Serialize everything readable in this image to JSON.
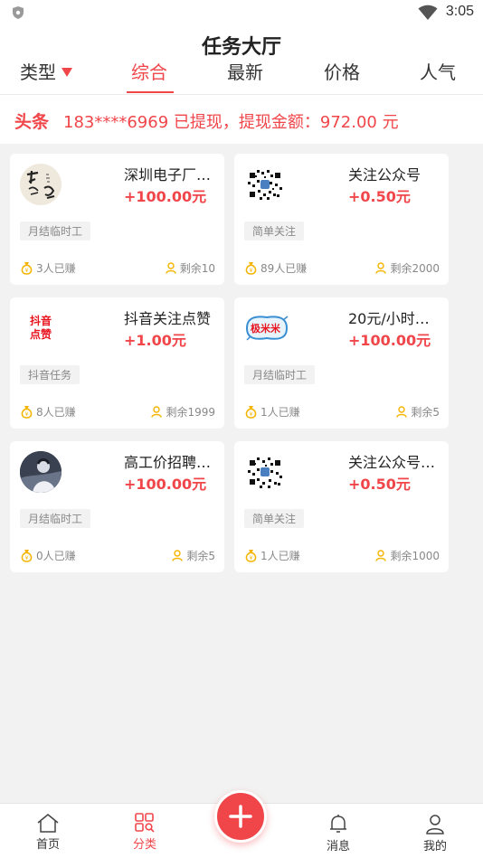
{
  "status_bar": {
    "time": "3:05"
  },
  "header": {
    "title": "任务大厅",
    "tabs": [
      {
        "label": "类型",
        "active": false,
        "has_dropdown": true
      },
      {
        "label": "综合",
        "active": true
      },
      {
        "label": "最新",
        "active": false
      },
      {
        "label": "价格",
        "active": false
      },
      {
        "label": "人气",
        "active": false
      }
    ]
  },
  "ticker": {
    "tag": "头条",
    "message": "183****6969 已提现，提现金额：972.00 元"
  },
  "tasks": [
    {
      "title": "深圳电子厂…",
      "price": "+100.00元",
      "tag": "月结临时工",
      "earned": "3人已赚",
      "remaining": "剩余10",
      "thumb": "calligraphy-avatar"
    },
    {
      "title": "关注公众号",
      "price": "+0.50元",
      "tag": "简单关注",
      "earned": "89人已赚",
      "remaining": "剩余2000",
      "thumb": "qr-code"
    },
    {
      "title": "抖音关注点赞",
      "price": "+1.00元",
      "tag": "抖音任务",
      "earned": "8人已赚",
      "remaining": "剩余1999",
      "thumb": "douyin-text",
      "thumb_text": "抖音点赞"
    },
    {
      "title": "20元/小时…",
      "price": "+100.00元",
      "tag": "月结临时工",
      "earned": "1人已赚",
      "remaining": "剩余5",
      "thumb": "mimi-logo",
      "thumb_text": "极米米"
    },
    {
      "title": "高工价招聘…",
      "price": "+100.00元",
      "tag": "月结临时工",
      "earned": "0人已赚",
      "remaining": "剩余5",
      "thumb": "photo-avatar"
    },
    {
      "title": "关注公众号…",
      "price": "+0.50元",
      "tag": "简单关注",
      "earned": "1人已赚",
      "remaining": "剩余1000",
      "thumb": "qr-code"
    }
  ],
  "bottom_nav": [
    {
      "label": "首页",
      "icon": "home-icon",
      "active": false
    },
    {
      "label": "分类",
      "icon": "category-icon",
      "active": true
    },
    {
      "label": "消息",
      "icon": "bell-icon",
      "active": false
    },
    {
      "label": "我的",
      "icon": "user-icon",
      "active": false
    }
  ],
  "fab": {
    "icon": "plus-icon"
  },
  "colors": {
    "accent": "#f0464a",
    "background": "#f2f2f2",
    "coin": "#f5b400"
  }
}
